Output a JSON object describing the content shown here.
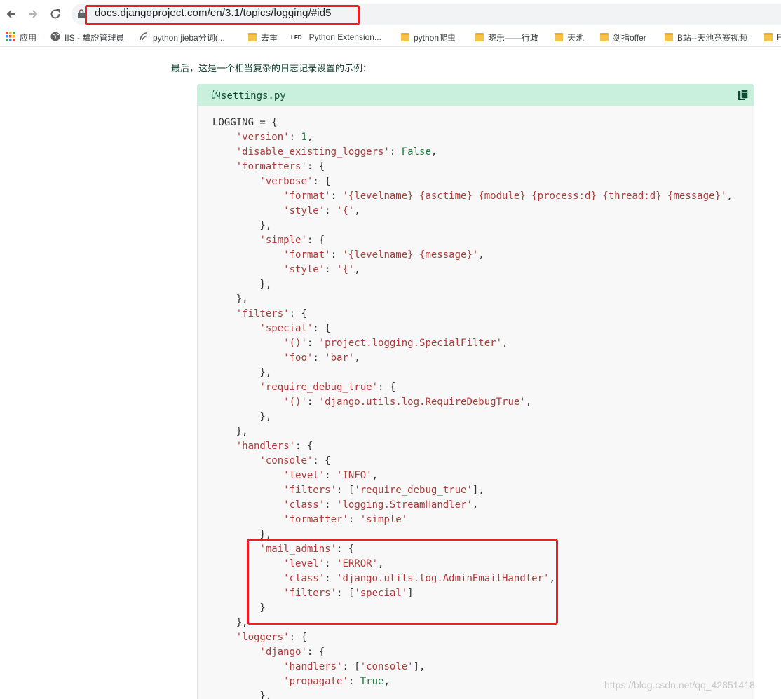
{
  "browser": {
    "url": "docs.djangoproject.com/en/3.1/topics/logging/#id5",
    "bookmarks": [
      {
        "label": "应用",
        "icon": "apps-grid-icon"
      },
      {
        "label": "IIS - 驗證管理員",
        "icon": "globe-icon"
      },
      {
        "label": "python jieba分词(...",
        "icon": "site-icon"
      },
      {
        "label": "去重",
        "icon": "folder-icon"
      },
      {
        "label": "Python Extension...",
        "icon": "lfd-icon",
        "badge": "LFD"
      },
      {
        "label": "python爬虫",
        "icon": "folder-icon"
      },
      {
        "label": "晓乐——行政",
        "icon": "folder-icon"
      },
      {
        "label": "天池",
        "icon": "folder-icon"
      },
      {
        "label": "剑指offer",
        "icon": "folder-icon"
      },
      {
        "label": "B站--天池竞赛视频",
        "icon": "folder-icon"
      },
      {
        "label": "F",
        "icon": "folder-icon"
      }
    ]
  },
  "page": {
    "intro": "最后，这是一个相当复杂的日志记录设置的示例：",
    "snippet": {
      "title": "的settings.py",
      "lines": [
        [
          [
            "p",
            "LOGGING = {"
          ]
        ],
        [
          [
            "p",
            "    "
          ],
          [
            "k",
            "'version'"
          ],
          [
            "p",
            ": "
          ],
          [
            "c",
            "1"
          ],
          [
            "p",
            ","
          ]
        ],
        [
          [
            "p",
            "    "
          ],
          [
            "k",
            "'disable_existing_loggers'"
          ],
          [
            "p",
            ": "
          ],
          [
            "c",
            "False"
          ],
          [
            "p",
            ","
          ]
        ],
        [
          [
            "p",
            "    "
          ],
          [
            "k",
            "'formatters'"
          ],
          [
            "p",
            ": {"
          ]
        ],
        [
          [
            "p",
            "        "
          ],
          [
            "k",
            "'verbose'"
          ],
          [
            "p",
            ": {"
          ]
        ],
        [
          [
            "p",
            "            "
          ],
          [
            "k",
            "'format'"
          ],
          [
            "p",
            ": "
          ],
          [
            "k",
            "'{levelname} {asctime} {module} {process:d} {thread:d} {message}'"
          ],
          [
            "p",
            ","
          ]
        ],
        [
          [
            "p",
            "            "
          ],
          [
            "k",
            "'style'"
          ],
          [
            "p",
            ": "
          ],
          [
            "k",
            "'{'"
          ],
          [
            "p",
            ","
          ]
        ],
        [
          [
            "p",
            "        },"
          ]
        ],
        [
          [
            "p",
            "        "
          ],
          [
            "k",
            "'simple'"
          ],
          [
            "p",
            ": {"
          ]
        ],
        [
          [
            "p",
            "            "
          ],
          [
            "k",
            "'format'"
          ],
          [
            "p",
            ": "
          ],
          [
            "k",
            "'{levelname} {message}'"
          ],
          [
            "p",
            ","
          ]
        ],
        [
          [
            "p",
            "            "
          ],
          [
            "k",
            "'style'"
          ],
          [
            "p",
            ": "
          ],
          [
            "k",
            "'{'"
          ],
          [
            "p",
            ","
          ]
        ],
        [
          [
            "p",
            "        },"
          ]
        ],
        [
          [
            "p",
            "    },"
          ]
        ],
        [
          [
            "p",
            "    "
          ],
          [
            "k",
            "'filters'"
          ],
          [
            "p",
            ": {"
          ]
        ],
        [
          [
            "p",
            "        "
          ],
          [
            "k",
            "'special'"
          ],
          [
            "p",
            ": {"
          ]
        ],
        [
          [
            "p",
            "            "
          ],
          [
            "k",
            "'()'"
          ],
          [
            "p",
            ": "
          ],
          [
            "k",
            "'project.logging.SpecialFilter'"
          ],
          [
            "p",
            ","
          ]
        ],
        [
          [
            "p",
            "            "
          ],
          [
            "k",
            "'foo'"
          ],
          [
            "p",
            ": "
          ],
          [
            "k",
            "'bar'"
          ],
          [
            "p",
            ","
          ]
        ],
        [
          [
            "p",
            "        },"
          ]
        ],
        [
          [
            "p",
            "        "
          ],
          [
            "k",
            "'require_debug_true'"
          ],
          [
            "p",
            ": {"
          ]
        ],
        [
          [
            "p",
            "            "
          ],
          [
            "k",
            "'()'"
          ],
          [
            "p",
            ": "
          ],
          [
            "k",
            "'django.utils.log.RequireDebugTrue'"
          ],
          [
            "p",
            ","
          ]
        ],
        [
          [
            "p",
            "        },"
          ]
        ],
        [
          [
            "p",
            "    },"
          ]
        ],
        [
          [
            "p",
            "    "
          ],
          [
            "k",
            "'handlers'"
          ],
          [
            "p",
            ": {"
          ]
        ],
        [
          [
            "p",
            "        "
          ],
          [
            "k",
            "'console'"
          ],
          [
            "p",
            ": {"
          ]
        ],
        [
          [
            "p",
            "            "
          ],
          [
            "k",
            "'level'"
          ],
          [
            "p",
            ": "
          ],
          [
            "k",
            "'INFO'"
          ],
          [
            "p",
            ","
          ]
        ],
        [
          [
            "p",
            "            "
          ],
          [
            "k",
            "'filters'"
          ],
          [
            "p",
            ": ["
          ],
          [
            "k",
            "'require_debug_true'"
          ],
          [
            "p",
            "],"
          ]
        ],
        [
          [
            "p",
            "            "
          ],
          [
            "k",
            "'class'"
          ],
          [
            "p",
            ": "
          ],
          [
            "k",
            "'logging.StreamHandler'"
          ],
          [
            "p",
            ","
          ]
        ],
        [
          [
            "p",
            "            "
          ],
          [
            "k",
            "'formatter'"
          ],
          [
            "p",
            ": "
          ],
          [
            "k",
            "'simple'"
          ]
        ],
        [
          [
            "p",
            "        },"
          ]
        ],
        [
          [
            "p",
            "        "
          ],
          [
            "k",
            "'mail_admins'"
          ],
          [
            "p",
            ": {"
          ]
        ],
        [
          [
            "p",
            "            "
          ],
          [
            "k",
            "'level'"
          ],
          [
            "p",
            ": "
          ],
          [
            "k",
            "'ERROR'"
          ],
          [
            "p",
            ","
          ]
        ],
        [
          [
            "p",
            "            "
          ],
          [
            "k",
            "'class'"
          ],
          [
            "p",
            ": "
          ],
          [
            "k",
            "'django.utils.log.AdminEmailHandler'"
          ],
          [
            "p",
            ","
          ]
        ],
        [
          [
            "p",
            "            "
          ],
          [
            "k",
            "'filters'"
          ],
          [
            "p",
            ": ["
          ],
          [
            "k",
            "'special'"
          ],
          [
            "p",
            "]"
          ]
        ],
        [
          [
            "p",
            "        }"
          ]
        ],
        [
          [
            "p",
            "    },"
          ]
        ],
        [
          [
            "p",
            "    "
          ],
          [
            "k",
            "'loggers'"
          ],
          [
            "p",
            ": {"
          ]
        ],
        [
          [
            "p",
            "        "
          ],
          [
            "k",
            "'django'"
          ],
          [
            "p",
            ": {"
          ]
        ],
        [
          [
            "p",
            "            "
          ],
          [
            "k",
            "'handlers'"
          ],
          [
            "p",
            ": ["
          ],
          [
            "k",
            "'console'"
          ],
          [
            "p",
            "],"
          ]
        ],
        [
          [
            "p",
            "            "
          ],
          [
            "k",
            "'propagate'"
          ],
          [
            "p",
            ": "
          ],
          [
            "c",
            "True"
          ],
          [
            "p",
            ","
          ]
        ],
        [
          [
            "p",
            "        },"
          ]
        ]
      ]
    }
  },
  "watermark": "https://blog.csdn.net/qq_42851418",
  "colors": {
    "annotation": "#ee1c25",
    "snippet_header": "#c9f0dd",
    "string": "#b03a3a",
    "constant": "#1a7a3e"
  }
}
